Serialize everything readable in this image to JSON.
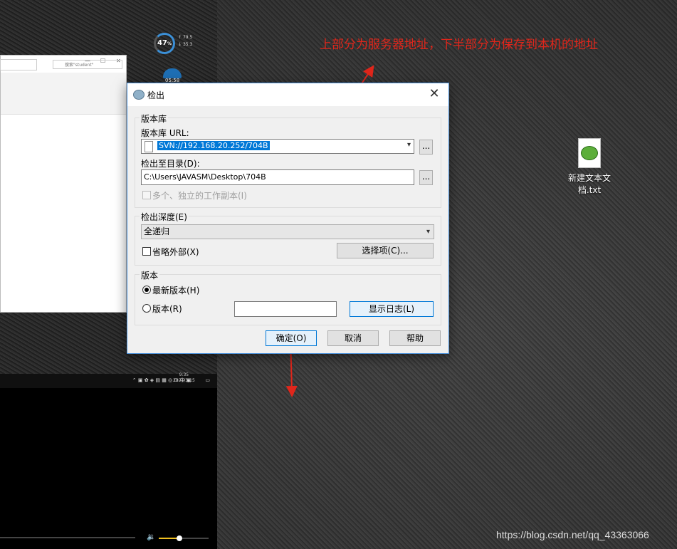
{
  "annotation": {
    "text": "上部分为服务器地址，下半部分为保存到本机的地址"
  },
  "left_screen": {
    "gauge_value": "47",
    "gauge_unit": "%",
    "net_up": "79.5",
    "net_down": "35.3",
    "widget_time": "05:58",
    "explorer_search_placeholder": "搜索\"student\"",
    "tray_time": "9:35",
    "tray_date": "2021/3/15"
  },
  "desktop_icon": {
    "label": "新建文本文档.txt"
  },
  "dialog": {
    "title": "检出",
    "repository": {
      "legend": "版本库",
      "url_label": "版本库 URL:",
      "url_value": "SVN://192.168.20.252/704B",
      "browse_label": "...",
      "dir_label": "检出至目录(D):",
      "dir_value": "C:\\Users\\JAVASM\\Desktop\\704B",
      "multi_label": "多个、独立的工作副本(I)"
    },
    "depth": {
      "legend": "检出深度(E)",
      "selected": "全递归",
      "omit_externals_label": "省略外部(X)",
      "choose_items_label": "选择项(C)..."
    },
    "revision": {
      "legend": "版本",
      "head_label": "最新版本(H)",
      "rev_label": "版本(R)",
      "rev_value": "",
      "show_log_label": "显示日志(L)"
    },
    "buttons": {
      "ok": "确定(O)",
      "cancel": "取消",
      "help": "帮助"
    }
  },
  "watermark": "https://blog.csdn.net/qq_43363066",
  "colors": {
    "annotation": "#e0261b",
    "selection": "#0078d7",
    "dialog_border": "#4a90d9"
  }
}
